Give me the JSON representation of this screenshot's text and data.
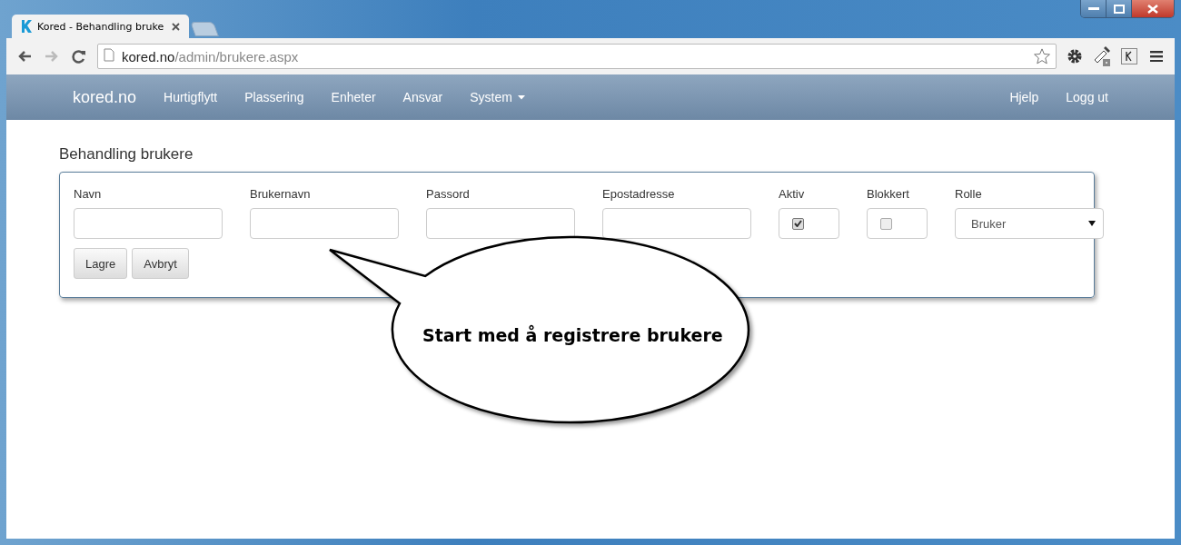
{
  "browser": {
    "tabs": [
      {
        "title": "Kored - Behandling bruke",
        "selected": true
      },
      {
        "selected": false
      }
    ],
    "address": {
      "host": "kored.no",
      "path": "/admin/brukere.aspx"
    }
  },
  "navbar": {
    "brand": "kored.no",
    "items": [
      {
        "label": "Hurtigflytt",
        "kind": "link"
      },
      {
        "label": "Plassering",
        "kind": "link"
      },
      {
        "label": "Enheter",
        "kind": "link"
      },
      {
        "label": "Ansvar",
        "kind": "link"
      },
      {
        "label": "System",
        "kind": "dropdown"
      }
    ],
    "right_items": [
      "Hjelp",
      "Logg ut"
    ]
  },
  "page": {
    "heading": "Behandling brukere",
    "fields": [
      {
        "label": "Navn",
        "kind": "text"
      },
      {
        "label": "Brukernavn",
        "kind": "text"
      },
      {
        "label": "Passord",
        "kind": "text"
      },
      {
        "label": "Epostadresse",
        "kind": "text"
      },
      {
        "label": "Aktiv",
        "kind": "checkbox",
        "checked": true
      },
      {
        "label": "Blokkert",
        "kind": "checkbox",
        "checked": false
      },
      {
        "label": "Rolle",
        "kind": "select",
        "value": "Bruker"
      }
    ],
    "buttons": [
      "Lagre",
      "Avbryt"
    ]
  },
  "callout": "Start med å registrere brukere"
}
